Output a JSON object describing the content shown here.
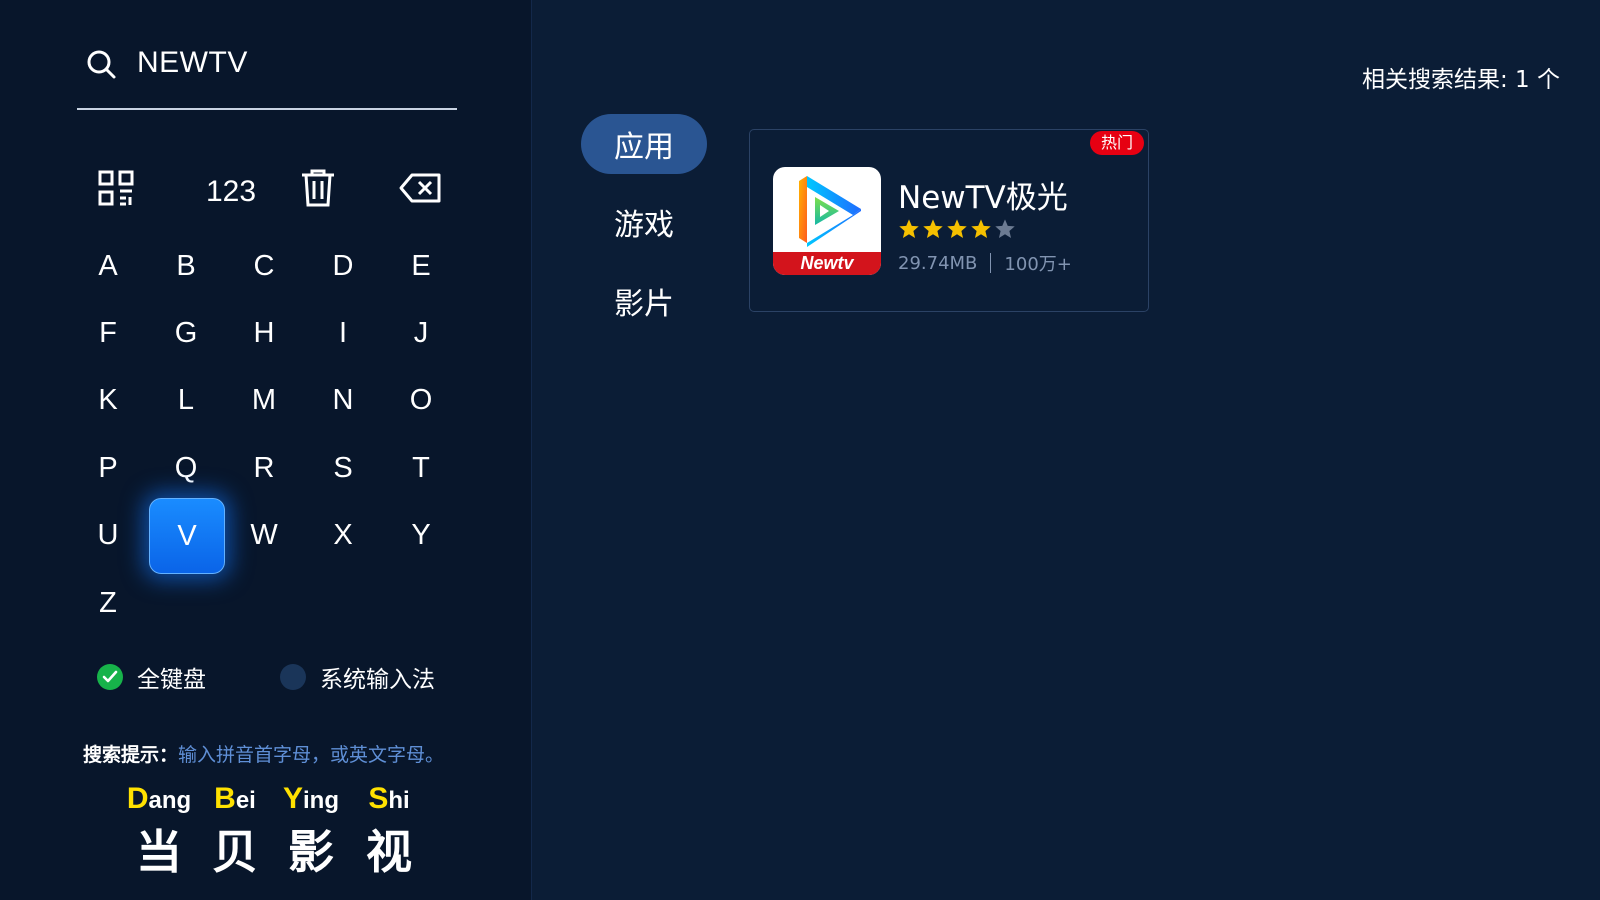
{
  "search": {
    "query": "NEWTV"
  },
  "keyboard": {
    "function_keys": [
      {
        "name": "qr-code-key",
        "icon": "qr-code-icon",
        "label": ""
      },
      {
        "name": "numeric-key",
        "icon": "",
        "label": "123"
      },
      {
        "name": "clear-key",
        "icon": "trash-icon",
        "label": ""
      },
      {
        "name": "backspace-key",
        "icon": "backspace-icon",
        "label": ""
      }
    ],
    "letters": [
      "A",
      "B",
      "C",
      "D",
      "E",
      "F",
      "G",
      "H",
      "I",
      "J",
      "K",
      "L",
      "M",
      "N",
      "O",
      "P",
      "Q",
      "R",
      "S",
      "T",
      "U",
      "V",
      "W",
      "X",
      "Y",
      "Z"
    ],
    "focused_letter": "V",
    "accent_color": "#0a6cf0"
  },
  "ime_options": [
    {
      "label": "全键盘",
      "selected": true
    },
    {
      "label": "系统输入法",
      "selected": false
    }
  ],
  "hint": {
    "label": "搜索提示：",
    "text": "输入拼音首字母，或英文字母。"
  },
  "brand": {
    "syllables": [
      {
        "initial": "D",
        "rest": "ang",
        "char": "当"
      },
      {
        "initial": "B",
        "rest": "ei",
        "char": "贝"
      },
      {
        "initial": "Y",
        "rest": "ing",
        "char": "影"
      },
      {
        "initial": "S",
        "rest": "hi",
        "char": "视"
      }
    ],
    "highlight_color": "#ffe100"
  },
  "results": {
    "count_text": "相关搜索结果: 1 个"
  },
  "categories": [
    {
      "label": "应用",
      "active": true
    },
    {
      "label": "游戏",
      "active": false
    },
    {
      "label": "影片",
      "active": false
    }
  ],
  "apps": [
    {
      "name": "NewTV极光",
      "badge": "热门",
      "icon_text": "Newtv",
      "rating": 4,
      "rating_max": 5,
      "size": "29.74MB",
      "downloads": "100万+",
      "badge_color": "#e60012",
      "star_color": "#f5c000"
    }
  ]
}
